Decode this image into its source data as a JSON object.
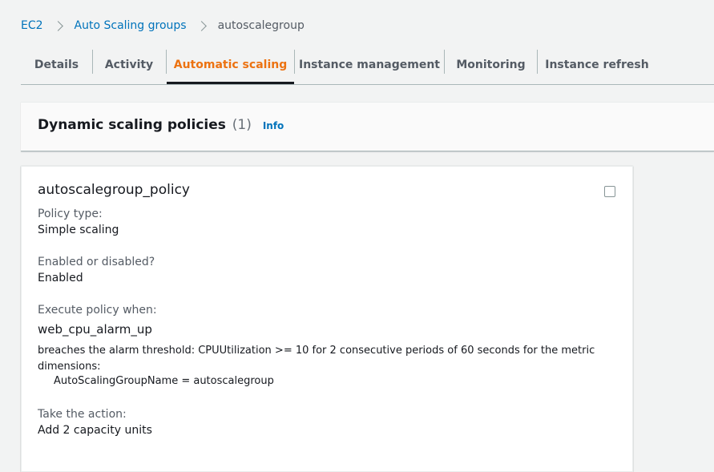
{
  "breadcrumb": {
    "items": [
      {
        "label": "EC2"
      },
      {
        "label": "Auto Scaling groups"
      },
      {
        "label": "autoscalegroup"
      }
    ]
  },
  "tabs": [
    {
      "label": "Details"
    },
    {
      "label": "Activity"
    },
    {
      "label": "Automatic scaling",
      "active": true
    },
    {
      "label": "Instance management"
    },
    {
      "label": "Monitoring"
    },
    {
      "label": "Instance refresh"
    }
  ],
  "policies_section": {
    "title": "Dynamic scaling policies",
    "count": "(1)",
    "info_label": "Info"
  },
  "policy": {
    "name": "autoscalegroup_policy",
    "checked": false,
    "policy_type_label": "Policy type:",
    "policy_type_value": "Simple scaling",
    "enabled_label": "Enabled or disabled?",
    "enabled_value": "Enabled",
    "execute_label": "Execute policy when:",
    "alarm_name": "web_cpu_alarm_up",
    "alarm_description": "breaches the alarm threshold: CPUUtilization >= 10 for 2 consecutive periods of 60 seconds for the metric dimensions:",
    "alarm_dimension": "AutoScalingGroupName = autoscalegroup",
    "action_label": "Take the action:",
    "action_value": "Add 2 capacity units"
  },
  "colors": {
    "link": "#0073bb",
    "active_tab": "#ec7211",
    "background": "#f2f3f3"
  }
}
